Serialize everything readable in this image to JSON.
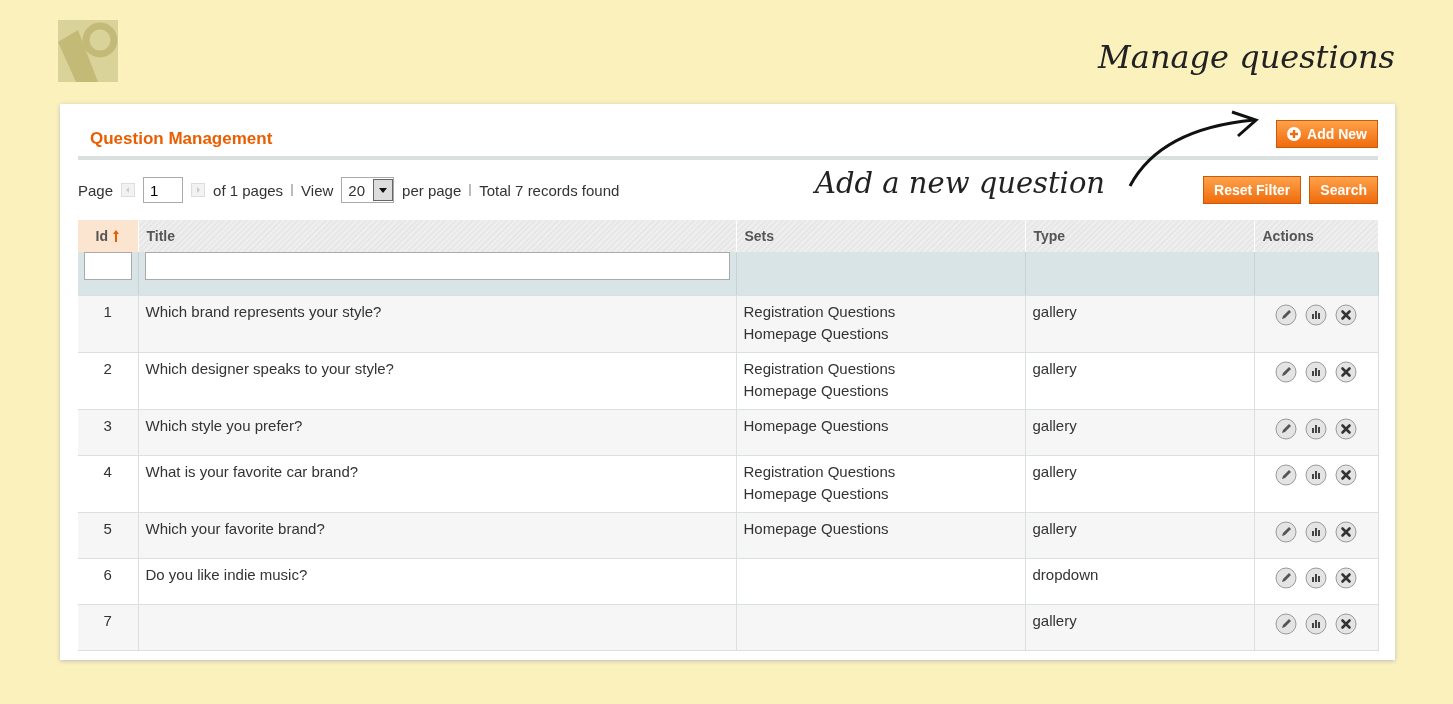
{
  "page_title": "Manage questions",
  "annotation": "Add a new question",
  "panel": {
    "title": "Question Management",
    "add_button": "Add New"
  },
  "pager": {
    "page_label": "Page",
    "page_value": "1",
    "of_pages": "of 1 pages",
    "view_label": "View",
    "per_page_value": "20",
    "per_page_label": "per page",
    "total": "Total 7 records found"
  },
  "filter_buttons": [
    "Reset Filter",
    "Search"
  ],
  "table": {
    "columns": [
      {
        "label": "Id",
        "sorted": true,
        "filterable": true
      },
      {
        "label": "Title",
        "sorted": false,
        "filterable": true
      },
      {
        "label": "Sets",
        "sorted": false,
        "filterable": false
      },
      {
        "label": "Type",
        "sorted": false,
        "filterable": false
      },
      {
        "label": "Actions",
        "sorted": false,
        "filterable": false
      }
    ],
    "rows": [
      {
        "id": "1",
        "title": "Which brand represents your style?",
        "sets": [
          "Registration Questions",
          "Homepage Questions"
        ],
        "type": "gallery"
      },
      {
        "id": "2",
        "title": "Which designer speaks to your style?",
        "sets": [
          "Registration Questions",
          "Homepage Questions"
        ],
        "type": "gallery"
      },
      {
        "id": "3",
        "title": "Which style you prefer?",
        "sets": [
          "Homepage Questions"
        ],
        "type": "gallery"
      },
      {
        "id": "4",
        "title": "What is your favorite car brand?",
        "sets": [
          "Registration Questions",
          "Homepage Questions"
        ],
        "type": "gallery"
      },
      {
        "id": "5",
        "title": "Which your favorite brand?",
        "sets": [
          "Homepage Questions"
        ],
        "type": "gallery"
      },
      {
        "id": "6",
        "title": "Do you like indie music?",
        "sets": [],
        "type": "dropdown"
      },
      {
        "id": "7",
        "sets": [],
        "type": "gallery"
      }
    ]
  }
}
